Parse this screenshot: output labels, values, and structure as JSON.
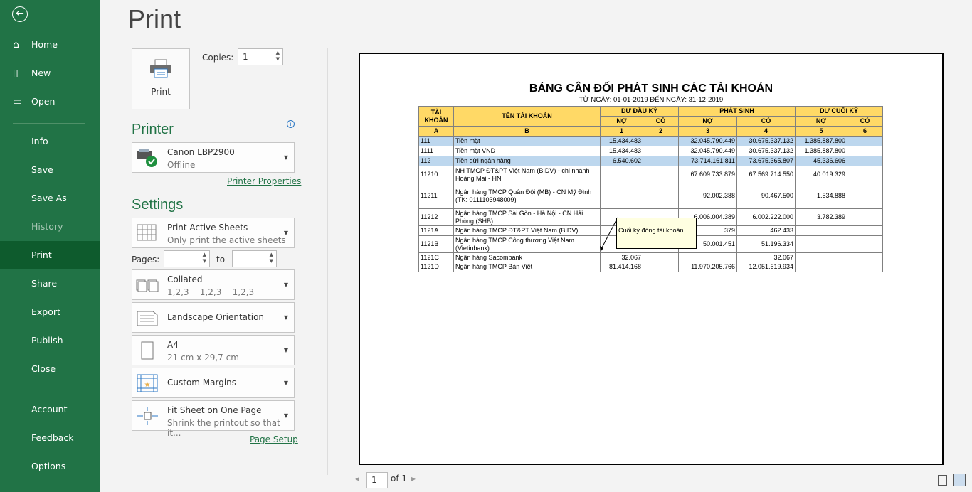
{
  "sidebar": {
    "items": [
      {
        "label": "Home",
        "icon": "home-icon"
      },
      {
        "label": "New",
        "icon": "new-icon"
      },
      {
        "label": "Open",
        "icon": "folder-icon"
      },
      {
        "label": "Info"
      },
      {
        "label": "Save"
      },
      {
        "label": "Save As"
      },
      {
        "label": "History"
      },
      {
        "label": "Print"
      },
      {
        "label": "Share"
      },
      {
        "label": "Export"
      },
      {
        "label": "Publish"
      },
      {
        "label": "Close"
      },
      {
        "label": "Account"
      },
      {
        "label": "Feedback"
      },
      {
        "label": "Options"
      }
    ]
  },
  "title": "Print",
  "print_button": "Print",
  "copies": {
    "label": "Copies:",
    "value": "1"
  },
  "printer": {
    "heading": "Printer",
    "name": "Canon LBP2900",
    "status": "Offline",
    "properties_link": "Printer Properties"
  },
  "settings": {
    "heading": "Settings",
    "active": {
      "t1": "Print Active Sheets",
      "t2": "Only print the active sheets"
    },
    "pages_label": "Pages:",
    "to_label": "to",
    "collated": {
      "t1": "Collated",
      "t2": "1,2,3    1,2,3    1,2,3"
    },
    "orientation": "Landscape Orientation",
    "paper": {
      "t1": "A4",
      "t2": "21 cm x 29,7 cm"
    },
    "margins": "Custom Margins",
    "scaling": {
      "t1": "Fit Sheet on One Page",
      "t2": "Shrink the printout so that it..."
    },
    "page_setup_link": "Page Setup"
  },
  "preview": {
    "title": "BẢNG CÂN ĐỐI PHÁT SINH CÁC TÀI KHOẢN",
    "subtitle": "TỪ NGÀY: 01-01-2019 ĐẾN NGÀY: 31-12-2019",
    "headers": {
      "acct": "TÀI KHOẢN",
      "name": "TÊN TÀI KHOẢN",
      "opening": "DƯ ĐẦU KỲ",
      "movement": "PHÁT SINH",
      "closing": "DƯ CUỐI KỲ",
      "debit": "NỢ",
      "credit": "CÓ",
      "codes": [
        "A",
        "B",
        "1",
        "2",
        "3",
        "4",
        "5",
        "6"
      ]
    },
    "rows": [
      [
        "111",
        "Tiền mặt",
        "15.434.483",
        "",
        "32.045.790.449",
        "30.675.337.132",
        "1.385.887.800",
        ""
      ],
      [
        "1111",
        "Tiền mặt VND",
        "15.434.483",
        "",
        "32.045.790.449",
        "30.675.337.132",
        "1.385.887.800",
        ""
      ],
      [
        "112",
        "Tiền gửi ngân hàng",
        "6.540.602",
        "",
        "73.714.161.811",
        "73.675.365.807",
        "45.336.606",
        ""
      ],
      [
        "11210",
        "NH TMCP ĐT&PT Việt Nam (BIDV) - chi nhánh Hoàng Mai - HN",
        "",
        "",
        "67.609.733.879",
        "67.569.714.550",
        "40.019.329",
        ""
      ],
      [
        "11211",
        "Ngân hàng TMCP Quân Đội (MB) - CN Mỹ Đình (TK: 0111103948009)",
        "",
        "",
        "92.002.388",
        "90.467.500",
        "1.534.888",
        ""
      ],
      [
        "11212",
        "Ngân hàng TMCP Sài Gòn - Hà Nội - CN Hải Phòng (SHB)",
        "",
        "",
        "6.006.004.389",
        "6.002.222.000",
        "3.782.389",
        ""
      ],
      [
        "1121A",
        "Ngân hàng TMCP ĐT&PT Việt Nam (BIDV)",
        "",
        "",
        "379",
        "462.433",
        "",
        ""
      ],
      [
        "1121B",
        "Ngân hàng TMCP Công thương Việt Nam (Vietinbank)",
        "",
        "",
        "50.001.451",
        "51.196.334",
        "",
        ""
      ],
      [
        "1121C",
        "Ngân hàng Sacombank",
        "32.067",
        "",
        "",
        "32.067",
        "",
        ""
      ],
      [
        "1121D",
        "Ngân hàng TMCP Bản Việt",
        "81.414.168",
        "",
        "11.970.205.766",
        "12.051.619.934",
        "",
        ""
      ]
    ],
    "highlight_rows": [
      0,
      2
    ],
    "comment": "Cuối kỳ đóng tài khoản"
  },
  "pager": {
    "current": "1",
    "of": "of 1"
  }
}
